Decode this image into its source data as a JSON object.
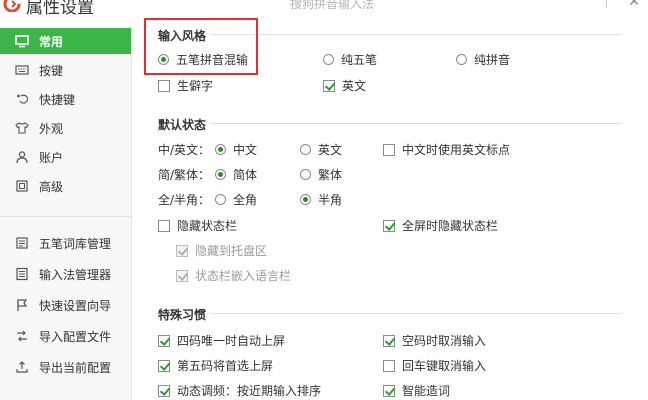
{
  "window": {
    "title": "属性设置",
    "subtitle_faded": "搜狗拼音输入法"
  },
  "sidebar": {
    "items": [
      {
        "label": "常用",
        "icon": "monitor-icon",
        "active": true
      },
      {
        "label": "按键",
        "icon": "keyboard-icon"
      },
      {
        "label": "快捷键",
        "icon": "shortcut-icon"
      },
      {
        "label": "外观",
        "icon": "shirt-icon"
      },
      {
        "label": "账户",
        "icon": "user-icon"
      },
      {
        "label": "高级",
        "icon": "advanced-icon"
      },
      {
        "label": "五笔词库管理",
        "icon": "dictionary-icon"
      },
      {
        "label": "输入法管理器",
        "icon": "manager-icon"
      },
      {
        "label": "快速设置向导",
        "icon": "flag-icon"
      },
      {
        "label": "导入配置文件",
        "icon": "import-icon"
      },
      {
        "label": "导出当前配置",
        "icon": "export-icon"
      }
    ]
  },
  "input_style": {
    "title": "输入风格",
    "options": [
      "五笔拼音混输",
      "纯五笔",
      "纯拼音"
    ],
    "selected": "五笔拼音混输",
    "rare_char": "生僻字",
    "english": "英文"
  },
  "default_status": {
    "title": "默认状态",
    "cn_en": {
      "label": "中/英文：",
      "options": [
        "中文",
        "英文"
      ],
      "selected": "中文"
    },
    "cn_en_punct": "中文时使用英文标点",
    "simp_trad": {
      "label": "简/繁体：",
      "options": [
        "简体",
        "繁体"
      ],
      "selected": "简体"
    },
    "width": {
      "label": "全/半角：",
      "options": [
        "全角",
        "半角"
      ],
      "selected": "半角"
    },
    "hide_status_bar": "隐藏状态栏",
    "hide_on_fullscreen": "全屏时隐藏状态栏",
    "hide_to_tray": "隐藏到托盘区",
    "embed_lang_bar": "状态栏嵌入语言栏"
  },
  "special_habits": {
    "title": "特殊习惯",
    "four_code_unique": "四码唯一时自动上屏",
    "empty_code_cancel": "空码时取消输入",
    "fifth_code_first": "第五码将首选上屏",
    "enter_cancel": "回车键取消输入",
    "dynamic_freq": "动态调频：按近期输入排序",
    "smart_word": "智能造词"
  },
  "colors": {
    "accent": "#3cb44a",
    "highlight": "#e03030"
  }
}
